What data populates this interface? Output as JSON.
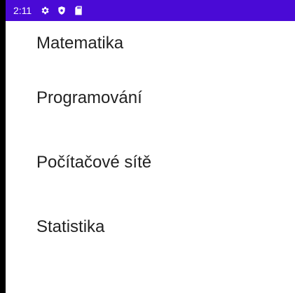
{
  "colors": {
    "status_bar_bg": "#4a0ad6",
    "screen_bg": "#ffffff",
    "bezel": "#000000",
    "text": "#222222"
  },
  "status_bar": {
    "time": "2:11",
    "icons": [
      "gear-icon",
      "shield-icon",
      "sd-card-icon"
    ]
  },
  "list": {
    "items": [
      {
        "label": "Matematika"
      },
      {
        "label": "Programování"
      },
      {
        "label": "Počítačové sítě"
      },
      {
        "label": "Statistika"
      }
    ]
  }
}
